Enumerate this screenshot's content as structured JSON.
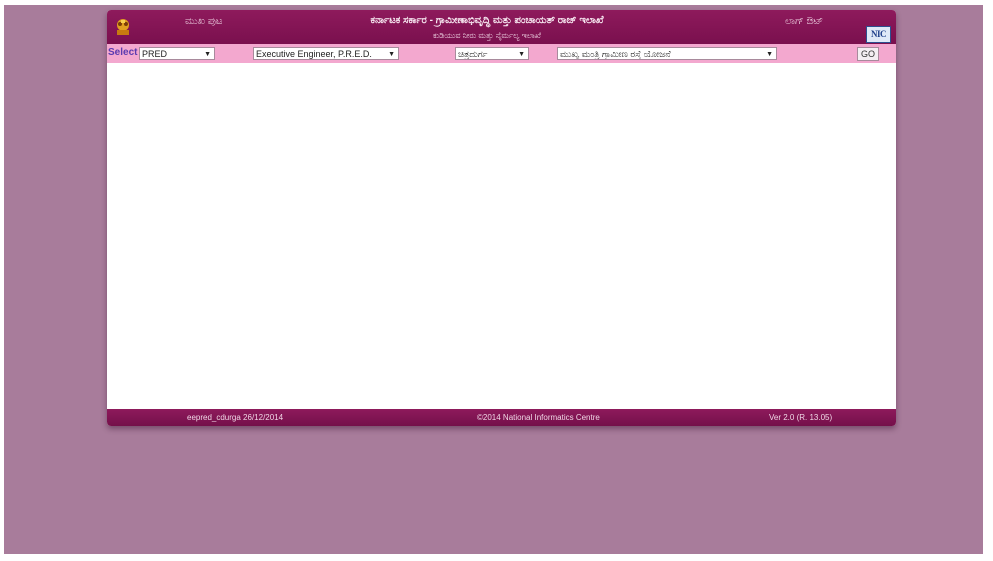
{
  "header": {
    "home_link": "ಮುಖ ಪುಟ",
    "title": "ಕರ್ನಾಟಕ ಸರ್ಕಾರ - ಗ್ರಾಮೀಣಾಭಿವೃದ್ಧಿ ಮತ್ತು ಪಂಚಾಯತ್ ರಾಜ್ ಇಲಾಖೆ",
    "subtitle": "ಕುಡಿಯುವ ನೀರು ಮತ್ತು ನೈರ್ಮಲ್ಯ ಇಲಾಖೆ",
    "logout_link": "ಲಾಗ್ ಔಟ್",
    "nic_logo": "NIC"
  },
  "toolbar": {
    "select_label": "Select",
    "department_select": "PRED",
    "office_select": "Executive Engineer, P.R.E.D.",
    "district_select": "ಚಿತ್ರದುರ್ಗ",
    "scheme_select": "ಮುಖ್ಯ ಮಂತ್ರಿ ಗ್ರಾಮೀಣ ರಸ್ತೆ ಯೋಜನೆ",
    "go_label": "GO"
  },
  "footer": {
    "user_date": "eepred_cdurga 26/12/2014",
    "copyright": "©2014 National Informatics Centre",
    "version": "Ver 2.0 (R. 13.05)"
  },
  "colors": {
    "background": "#a87c9b",
    "header": "#8e1a5c",
    "toolbar": "#f3a8cf"
  }
}
